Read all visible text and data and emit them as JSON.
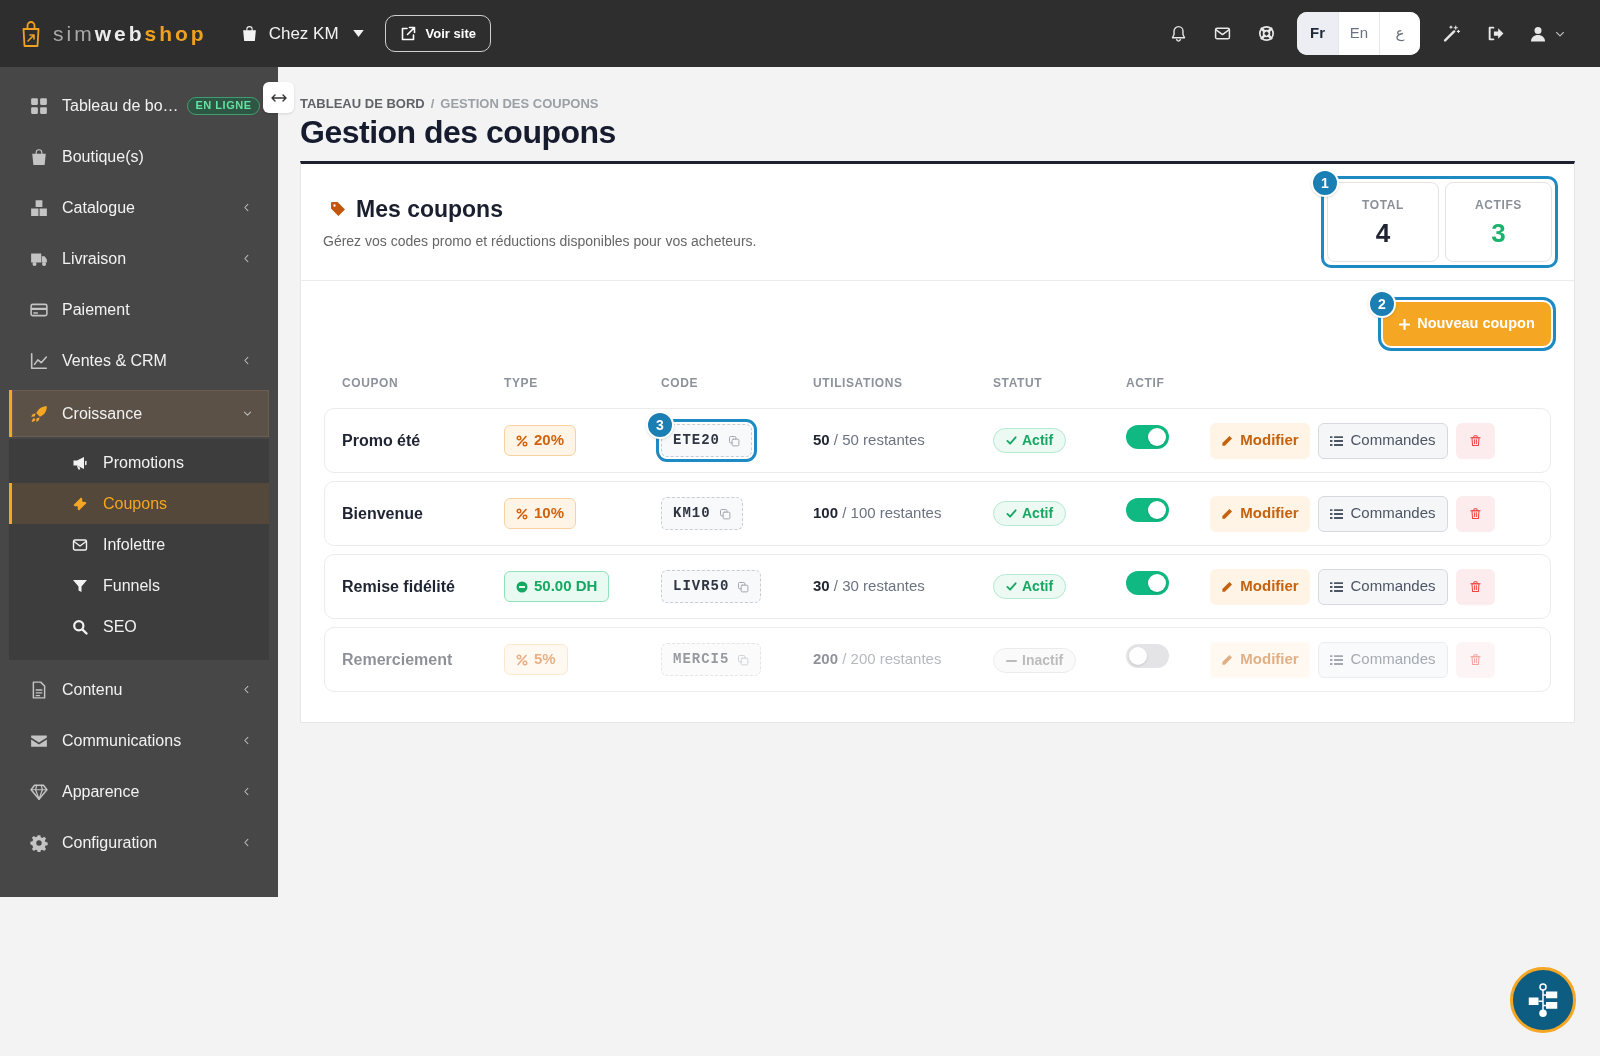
{
  "topbar": {
    "logo_parts": [
      "sim",
      "web",
      "shop"
    ],
    "store_selector": {
      "label": "Chez KM"
    },
    "view_site_button": "Voir site",
    "languages": [
      {
        "label": "Fr",
        "selected": true
      },
      {
        "label": "En",
        "selected": false
      },
      {
        "label": "ع",
        "selected": false
      }
    ]
  },
  "sidebar": {
    "items": [
      {
        "label": "Tableau de bo…",
        "badge": "EN LIGNE",
        "selected": false
      },
      {
        "label": "Boutique(s)",
        "selected": false
      },
      {
        "label": "Catalogue",
        "selected": false,
        "expanded": false
      },
      {
        "label": "Livraison",
        "selected": false,
        "expanded": false
      },
      {
        "label": "Paiement",
        "selected": false
      },
      {
        "label": "Ventes & CRM",
        "selected": false,
        "expanded": false
      },
      {
        "label": "Croissance",
        "selected": true,
        "expanded": true,
        "children": [
          {
            "label": "Promotions",
            "selected": false
          },
          {
            "label": "Coupons",
            "selected": true
          },
          {
            "label": "Infolettre",
            "selected": false
          },
          {
            "label": "Funnels",
            "selected": false
          },
          {
            "label": "SEO",
            "selected": false
          }
        ]
      },
      {
        "label": "Contenu",
        "selected": false,
        "expanded": false
      },
      {
        "label": "Communications",
        "selected": false,
        "expanded": false
      },
      {
        "label": "Apparence",
        "selected": false,
        "expanded": false
      },
      {
        "label": "Configuration",
        "selected": false,
        "expanded": false
      }
    ]
  },
  "breadcrumb": {
    "separator": "/",
    "items": [
      {
        "label": "TABLEAU DE BORD",
        "current": false
      },
      {
        "label": "GESTION DES COUPONS",
        "current": true
      }
    ]
  },
  "page_title": "Gestion des coupons",
  "coupons_card": {
    "title": "Mes coupons",
    "subtitle": "Gérez vos codes promo et réductions disponibles pour vos acheteurs.",
    "stats": {
      "tour_step": "1",
      "items": [
        {
          "kind": "total",
          "label": "TOTAL",
          "value": "4"
        },
        {
          "kind": "active",
          "label": "ACTIFS",
          "value": "3"
        }
      ]
    },
    "new_coupon_button": {
      "label": "Nouveau coupon",
      "tour_step": "2"
    },
    "table": {
      "columns": [
        "COUPON",
        "TYPE",
        "CODE",
        "UTILISATIONS",
        "STATUT",
        "ACTIF"
      ],
      "rows": [
        {
          "name": "Promo été",
          "type": {
            "kind": "percent",
            "label": "20%"
          },
          "code": "ETE20",
          "tour_step": "3",
          "usage": "**50** / 50 restantes",
          "status": {
            "kind": "active",
            "label": "Actif"
          },
          "on": true,
          "edit_button": "Modifier",
          "orders_button": "Commandes"
        },
        {
          "name": "Bienvenue",
          "type": {
            "kind": "percent",
            "label": "10%"
          },
          "code": "KM10",
          "usage": "**100** / 100 restantes",
          "status": {
            "kind": "active",
            "label": "Actif"
          },
          "on": true,
          "edit_button": "Modifier",
          "orders_button": "Commandes"
        },
        {
          "name": "Remise fidélité",
          "type": {
            "kind": "fixed",
            "label": "50.00 DH"
          },
          "code": "LIVR50",
          "usage": "**30** / 30 restantes",
          "status": {
            "kind": "active",
            "label": "Actif"
          },
          "on": true,
          "edit_button": "Modifier",
          "orders_button": "Commandes"
        },
        {
          "name": "Remerciement",
          "type": {
            "kind": "percent",
            "label": "5%"
          },
          "code": "MERCI5",
          "usage": "**200** / 200 restantes",
          "status": {
            "kind": "inactive",
            "label": "Inactif"
          },
          "on": false,
          "edit_button": "Modifier",
          "orders_button": "Commandes"
        }
      ]
    }
  }
}
